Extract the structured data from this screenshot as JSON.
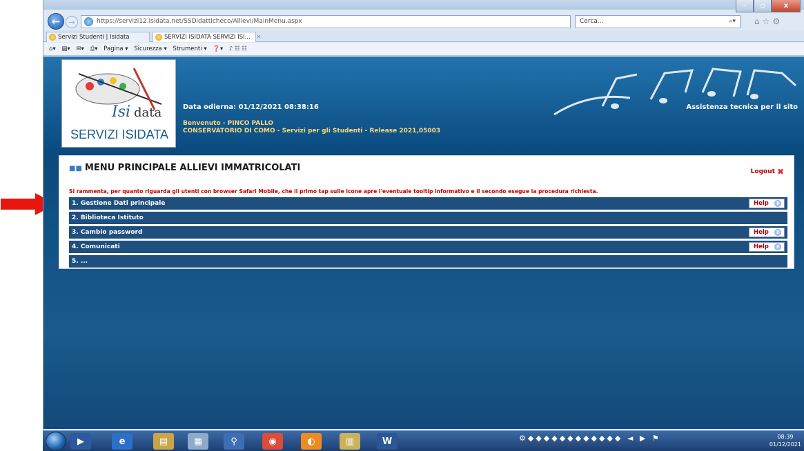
{
  "browser": {
    "url": "https://servizi12.isidata.net/SSDidatticheco/Allievi/MainMenu.aspx",
    "search_placeholder": "Cerca...",
    "tabs": [
      {
        "label": "Servizi Studenti | Isidata"
      },
      {
        "label": "SERVIZI ISIDATA SERVIZI ISI...",
        "close": "×"
      }
    ],
    "commands": [
      "Pagina ▾",
      "Sicurezza ▾",
      "Strumenti ▾"
    ],
    "win_close": "x"
  },
  "header": {
    "logo_text": "SERVIZI ISIDATA",
    "date_line": "Data odierna: 01/12/2021 08:38:16",
    "assist_link": "Assistenza tecnica per il sito",
    "welcome": "Benvenuto - PINCO PALLO",
    "institute": "CONSERVATORIO DI COMO - Servizi per gli Studenti - Release 2021,05003"
  },
  "menu": {
    "title": "MENU PRINCIPALE ALLIEVI IMMATRICOLATI",
    "logout": "Logout",
    "notice": "Si rammenta, per quanto riguarda gli utenti con browser Safari Mobile, che il primo tap sulle icone apre l'eventuale tooltip informativo e il secondo esegue la procedura richiesta.",
    "items": [
      {
        "label": "1. Gestione Dati principale",
        "help": "Help"
      },
      {
        "label": "2. Biblioteca Istituto",
        "help": ""
      },
      {
        "label": "3. Cambio password",
        "help": "Help"
      },
      {
        "label": "4. Comunicati",
        "help": "Help"
      },
      {
        "label": "5. ...",
        "help": ""
      }
    ]
  },
  "taskbar": {
    "clock_time": "08:39",
    "clock_date": "01/12/2021",
    "word_label": "W"
  },
  "colors": {
    "accent_arrow": "#e8160c",
    "menu_row": "#1e4f7e",
    "notice": "#c00000"
  }
}
